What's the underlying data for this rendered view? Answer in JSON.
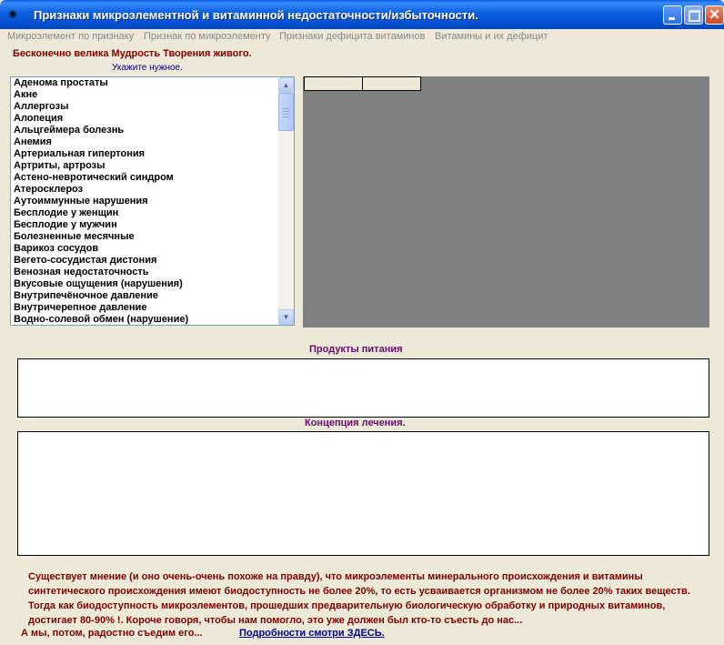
{
  "window": {
    "title": "Признаки микроэлементной и витаминной недостаточности/избыточности.",
    "app_icon": "bug-icon",
    "controls": [
      "minimize",
      "maximize",
      "close"
    ],
    "close_glyph": "✕"
  },
  "menu": [
    "Микроэлемент по признаку",
    "Признак по микроэлементу",
    "Признаки дефицита витаминов",
    "Витамины и их дефицит"
  ],
  "motto": "Бесконечно велика Мудрость Творения живого.",
  "hint": "Укажите нужное.",
  "list": {
    "items": [
      "Аденома  простаты",
      "Акне",
      "Аллергозы",
      "Алопеция",
      "Альцгеймера болезнь",
      "Анемия",
      "Артериальная гипертония",
      "Артриты, артрозы",
      "Астено-невротический синдром",
      "Атеросклероз",
      "Аутоиммунные нарушения",
      "Бесплодие у женщин",
      "Бесплодие у мужчин",
      "Болезненные месячные",
      "Варикоз сосудов",
      "Вегето-сосудистая дистония",
      "Венозная недостаточность",
      "Вкусовые ощущения (нарушения)",
      "Внутрипечёночное давление",
      "Внутричерепное давление",
      "Водно-солевой обмен (нарушение)"
    ],
    "scroll_up_glyph": "▲",
    "scroll_down_glyph": "▼"
  },
  "grid": {
    "columns": [
      "",
      ""
    ]
  },
  "products": {
    "label": "Продукты питания",
    "value": ""
  },
  "treatment": {
    "label": "Концепция лечения.",
    "value": ""
  },
  "note": "Существует мнение (и оно очень-очень похоже на правду), что микроэлементы минерального происхождения и витамины синтетического происхождения имеют биодоступность не более 20%, то есть усваивается организмом не более 20% таких веществ. Тогда как биодоступность микроэлементов, прошедших предварительную биологическую обработку и природных витаминов, достигает 80-90% !.  Короче говоря, чтобы нам помогло, это уже должен был кто-то съесть до нас...",
  "footer": {
    "text": "А мы, потом, радостно съедим его...",
    "link": "Подробности смотри ЗДЕСЬ."
  },
  "colors": {
    "window_bg": "#ece9d8",
    "titlebar": "#0a5ee0",
    "motto": "#800000",
    "section_label": "#6b0b6b",
    "grid_bg": "#808080",
    "link": "#00008b"
  }
}
